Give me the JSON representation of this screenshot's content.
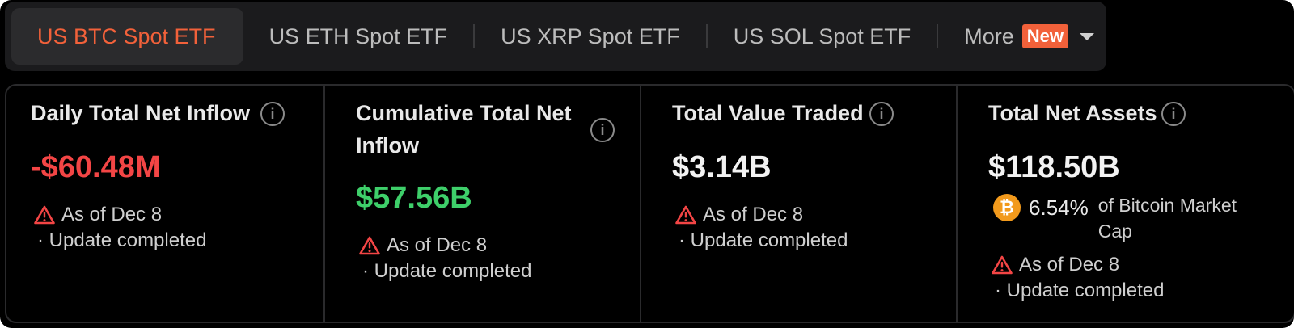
{
  "tabs": {
    "items": [
      {
        "label": "US BTC Spot ETF"
      },
      {
        "label": "US ETH Spot ETF"
      },
      {
        "label": "US XRP Spot ETF"
      },
      {
        "label": "US SOL Spot ETF"
      }
    ],
    "more_label": "More",
    "new_badge": "New"
  },
  "colors": {
    "accent": "#f2613a",
    "negative": "#f34545",
    "positive": "#3ecf6a",
    "bitcoin": "#f29a1c"
  },
  "cards": [
    {
      "title": "Daily Total Net Inflow",
      "value": "-$60.48M",
      "status_date": "As of Dec 8",
      "status_update": "· Update completed"
    },
    {
      "title": "Cumulative Total Net Inflow",
      "value": "$57.56B",
      "status_date": "As of Dec 8",
      "status_update": "· Update completed"
    },
    {
      "title": "Total Value Traded",
      "value": "$3.14B",
      "status_date": "As of Dec 8",
      "status_update": "· Update completed"
    },
    {
      "title": "Total Net Assets",
      "value": "$118.50B",
      "share_percent": "6.54%",
      "share_label": "of Bitcoin Market Cap",
      "status_date": "As of Dec 8",
      "status_update": "· Update completed"
    }
  ],
  "icons": {
    "info": "info-icon",
    "warning": "warning-icon",
    "bitcoin": "bitcoin-icon",
    "dropdown": "chevron-down-icon"
  }
}
